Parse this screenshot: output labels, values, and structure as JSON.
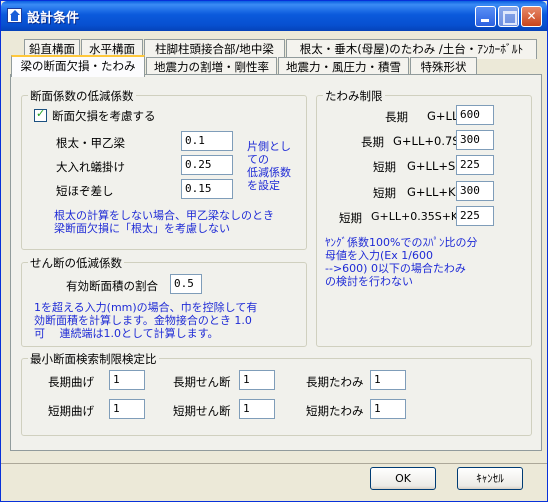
{
  "window": {
    "title": "設計条件"
  },
  "tabs_row1": [
    "鉛直構面",
    "水平構面",
    "柱脚柱頭接合部/地中梁",
    "根太・垂木(母屋)のたわみ /土台・ｱﾝｶｰﾎﾞﾙﾄ"
  ],
  "tabs_row2": [
    "梁の断面欠損・たわみ",
    "地震力の割増・剛性率",
    "地震力・風圧力・積雪",
    "特殊形状"
  ],
  "section_loss": {
    "title": "断面係数の低減係数",
    "checkbox_label": "断面欠損を考慮する",
    "rows": [
      {
        "label": "根太・甲乙梁",
        "value": "0.1"
      },
      {
        "label": "大入れ蟻掛け",
        "value": "0.25"
      },
      {
        "label": "短ほぞ差し",
        "value": "0.15"
      }
    ],
    "side_note": [
      "片側とし",
      "ての",
      "低減係数",
      "を設定"
    ],
    "note": [
      "根太の計算をしない場合、甲乙梁なしのとき",
      "梁断面欠損に「根太」を考慮しない"
    ]
  },
  "section_shear": {
    "title": "せん断の低減係数",
    "label": "有効断面積の割合",
    "value": "0.5",
    "note": [
      "1を超える入力(mm)の場合、巾を控除して有",
      "効断面積を計算します。金物接合のとき 1.0",
      "可　 連続端は1.0として計算します。"
    ]
  },
  "section_deflection": {
    "title": "たわみ制限",
    "rows": [
      {
        "term": "長期",
        "combo": "G+LL",
        "value": "600"
      },
      {
        "term": "長期",
        "combo": "G+LL+0.7S",
        "value": "300"
      },
      {
        "term": "短期",
        "combo": "G+LL+S",
        "value": "225"
      },
      {
        "term": "短期",
        "combo": "G+LL+K",
        "value": "300"
      },
      {
        "term": "短期",
        "combo": "G+LL+0.35S+K",
        "value": "225"
      }
    ],
    "note": [
      "ﾔﾝｸﾞ係数100%でのｽﾊﾟﾝ比の分",
      "母値を入力(Ex 1/600",
      "-->600) 0以下の場合たわみ",
      "の検討を行わない"
    ]
  },
  "section_ratio": {
    "title": "最小断面検索制限検定比",
    "items": [
      {
        "label": "長期曲げ",
        "value": "1"
      },
      {
        "label": "長期せん断",
        "value": "1"
      },
      {
        "label": "長期たわみ",
        "value": "1"
      },
      {
        "label": "短期曲げ",
        "value": "1"
      },
      {
        "label": "短期せん断",
        "value": "1"
      },
      {
        "label": "短期たわみ",
        "value": "1"
      }
    ]
  },
  "buttons": {
    "ok": "OK",
    "cancel": "ｷｬﾝｾﾙ"
  }
}
